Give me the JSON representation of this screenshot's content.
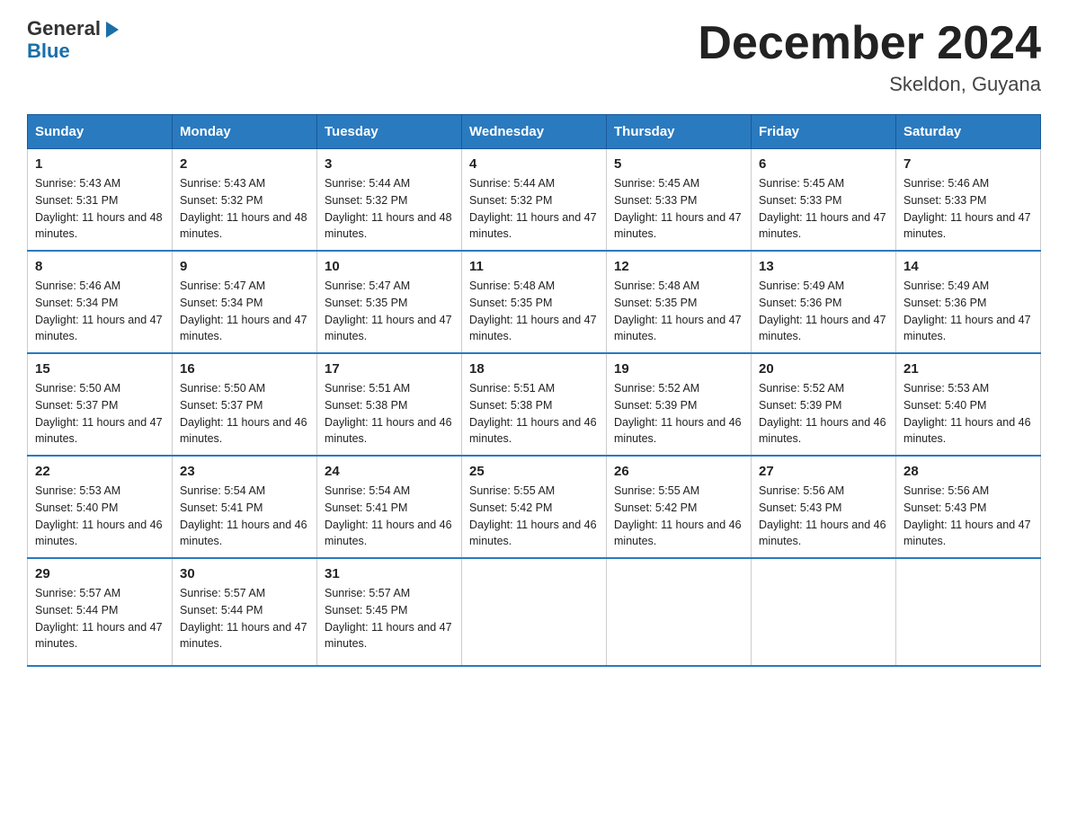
{
  "logo": {
    "line1": "General",
    "arrow": "▶",
    "line2": "Blue"
  },
  "title": "December 2024",
  "location": "Skeldon, Guyana",
  "days_header": [
    "Sunday",
    "Monday",
    "Tuesday",
    "Wednesday",
    "Thursday",
    "Friday",
    "Saturday"
  ],
  "weeks": [
    [
      {
        "day": "1",
        "sunrise": "5:43 AM",
        "sunset": "5:31 PM",
        "daylight": "11 hours and 48 minutes."
      },
      {
        "day": "2",
        "sunrise": "5:43 AM",
        "sunset": "5:32 PM",
        "daylight": "11 hours and 48 minutes."
      },
      {
        "day": "3",
        "sunrise": "5:44 AM",
        "sunset": "5:32 PM",
        "daylight": "11 hours and 48 minutes."
      },
      {
        "day": "4",
        "sunrise": "5:44 AM",
        "sunset": "5:32 PM",
        "daylight": "11 hours and 47 minutes."
      },
      {
        "day": "5",
        "sunrise": "5:45 AM",
        "sunset": "5:33 PM",
        "daylight": "11 hours and 47 minutes."
      },
      {
        "day": "6",
        "sunrise": "5:45 AM",
        "sunset": "5:33 PM",
        "daylight": "11 hours and 47 minutes."
      },
      {
        "day": "7",
        "sunrise": "5:46 AM",
        "sunset": "5:33 PM",
        "daylight": "11 hours and 47 minutes."
      }
    ],
    [
      {
        "day": "8",
        "sunrise": "5:46 AM",
        "sunset": "5:34 PM",
        "daylight": "11 hours and 47 minutes."
      },
      {
        "day": "9",
        "sunrise": "5:47 AM",
        "sunset": "5:34 PM",
        "daylight": "11 hours and 47 minutes."
      },
      {
        "day": "10",
        "sunrise": "5:47 AM",
        "sunset": "5:35 PM",
        "daylight": "11 hours and 47 minutes."
      },
      {
        "day": "11",
        "sunrise": "5:48 AM",
        "sunset": "5:35 PM",
        "daylight": "11 hours and 47 minutes."
      },
      {
        "day": "12",
        "sunrise": "5:48 AM",
        "sunset": "5:35 PM",
        "daylight": "11 hours and 47 minutes."
      },
      {
        "day": "13",
        "sunrise": "5:49 AM",
        "sunset": "5:36 PM",
        "daylight": "11 hours and 47 minutes."
      },
      {
        "day": "14",
        "sunrise": "5:49 AM",
        "sunset": "5:36 PM",
        "daylight": "11 hours and 47 minutes."
      }
    ],
    [
      {
        "day": "15",
        "sunrise": "5:50 AM",
        "sunset": "5:37 PM",
        "daylight": "11 hours and 47 minutes."
      },
      {
        "day": "16",
        "sunrise": "5:50 AM",
        "sunset": "5:37 PM",
        "daylight": "11 hours and 46 minutes."
      },
      {
        "day": "17",
        "sunrise": "5:51 AM",
        "sunset": "5:38 PM",
        "daylight": "11 hours and 46 minutes."
      },
      {
        "day": "18",
        "sunrise": "5:51 AM",
        "sunset": "5:38 PM",
        "daylight": "11 hours and 46 minutes."
      },
      {
        "day": "19",
        "sunrise": "5:52 AM",
        "sunset": "5:39 PM",
        "daylight": "11 hours and 46 minutes."
      },
      {
        "day": "20",
        "sunrise": "5:52 AM",
        "sunset": "5:39 PM",
        "daylight": "11 hours and 46 minutes."
      },
      {
        "day": "21",
        "sunrise": "5:53 AM",
        "sunset": "5:40 PM",
        "daylight": "11 hours and 46 minutes."
      }
    ],
    [
      {
        "day": "22",
        "sunrise": "5:53 AM",
        "sunset": "5:40 PM",
        "daylight": "11 hours and 46 minutes."
      },
      {
        "day": "23",
        "sunrise": "5:54 AM",
        "sunset": "5:41 PM",
        "daylight": "11 hours and 46 minutes."
      },
      {
        "day": "24",
        "sunrise": "5:54 AM",
        "sunset": "5:41 PM",
        "daylight": "11 hours and 46 minutes."
      },
      {
        "day": "25",
        "sunrise": "5:55 AM",
        "sunset": "5:42 PM",
        "daylight": "11 hours and 46 minutes."
      },
      {
        "day": "26",
        "sunrise": "5:55 AM",
        "sunset": "5:42 PM",
        "daylight": "11 hours and 46 minutes."
      },
      {
        "day": "27",
        "sunrise": "5:56 AM",
        "sunset": "5:43 PM",
        "daylight": "11 hours and 46 minutes."
      },
      {
        "day": "28",
        "sunrise": "5:56 AM",
        "sunset": "5:43 PM",
        "daylight": "11 hours and 47 minutes."
      }
    ],
    [
      {
        "day": "29",
        "sunrise": "5:57 AM",
        "sunset": "5:44 PM",
        "daylight": "11 hours and 47 minutes."
      },
      {
        "day": "30",
        "sunrise": "5:57 AM",
        "sunset": "5:44 PM",
        "daylight": "11 hours and 47 minutes."
      },
      {
        "day": "31",
        "sunrise": "5:57 AM",
        "sunset": "5:45 PM",
        "daylight": "11 hours and 47 minutes."
      },
      null,
      null,
      null,
      null
    ]
  ]
}
